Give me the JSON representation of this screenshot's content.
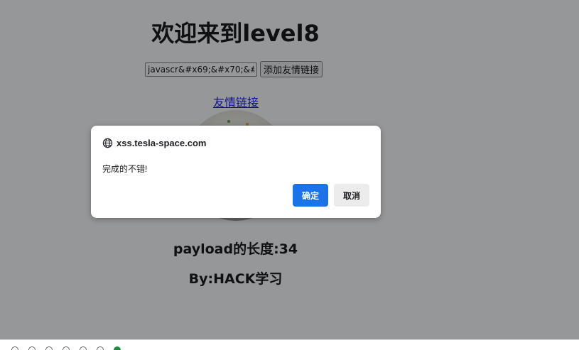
{
  "page": {
    "title": "欢迎来到level8",
    "input_value": "javascr&#x69;&#x70;&#x",
    "add_button_label": "添加友情链接",
    "friend_link_text": "友情链接",
    "payload_length": "payload的长度:34",
    "by_line": "By:HACK学习"
  },
  "dialog": {
    "origin": "xss.tesla-space.com",
    "message": "完成的不错!",
    "ok_label": "确定",
    "cancel_label": "取消",
    "ok_color": "#1a73e8"
  },
  "colors": {
    "overlay": "rgba(32,33,36,0.47)",
    "link": "#0000ee"
  }
}
